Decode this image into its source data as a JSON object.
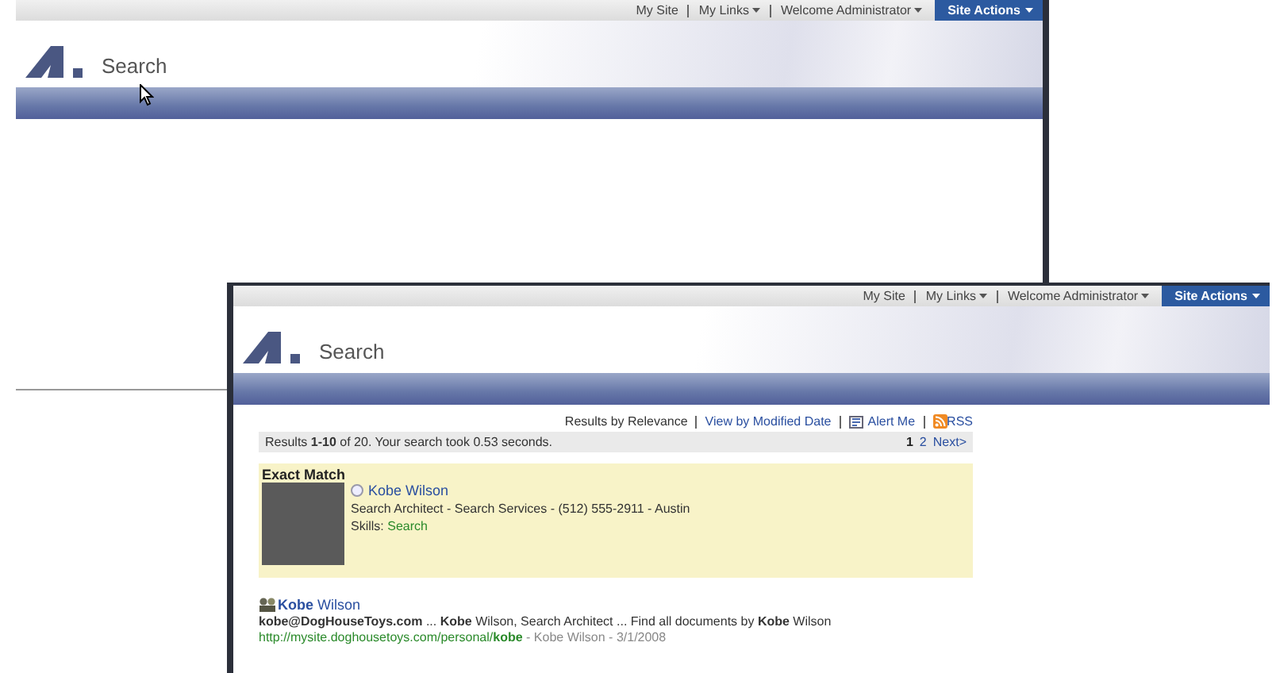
{
  "windows": [
    {
      "top_links": [
        {
          "label": "My Site",
          "dropdown": false
        },
        {
          "label": "My Links",
          "dropdown": true
        },
        {
          "label": "Welcome Administrator",
          "dropdown": true
        }
      ],
      "site_actions": "Site Actions",
      "title": "Search"
    },
    {
      "top_links": [
        {
          "label": "My Site",
          "dropdown": false
        },
        {
          "label": "My Links",
          "dropdown": true
        },
        {
          "label": "Welcome Administrator",
          "dropdown": true
        }
      ],
      "site_actions": "Site Actions",
      "title": "Search",
      "search": {
        "sort_links": [
          {
            "label": "Results by Relevance",
            "kind": "text"
          },
          {
            "label": "View by Modified Date",
            "kind": "link"
          },
          {
            "label": "Alert Me",
            "kind": "alert"
          },
          {
            "label": "RSS",
            "kind": "rss"
          }
        ],
        "summary": "Results **1-10** of 20. Your search took 0.53 seconds.",
        "pages": [
          {
            "label": "1",
            "selected": true
          },
          {
            "label": "2",
            "selected": false
          },
          {
            "label": "Next>",
            "selected": false
          }
        ],
        "exact_match": {
          "heading": "Exact Match",
          "name": "Kobe Wilson",
          "details": "Search Architect - Search Services - (512) 555-2911 - Austin",
          "skills_label": "Skills:",
          "skills": "Search"
        },
        "results": [
          {
            "title": "**Kobe** Wilson",
            "snippet": "**kobe@DogHouseToys.com** ... **Kobe** Wilson, Search Architect ... Find all documents by **Kobe** Wilson",
            "url": "http://mysite.doghousetoys.com/personal/**kobe**",
            "meta": " - Kobe Wilson - 3/1/2008"
          }
        ]
      }
    }
  ]
}
